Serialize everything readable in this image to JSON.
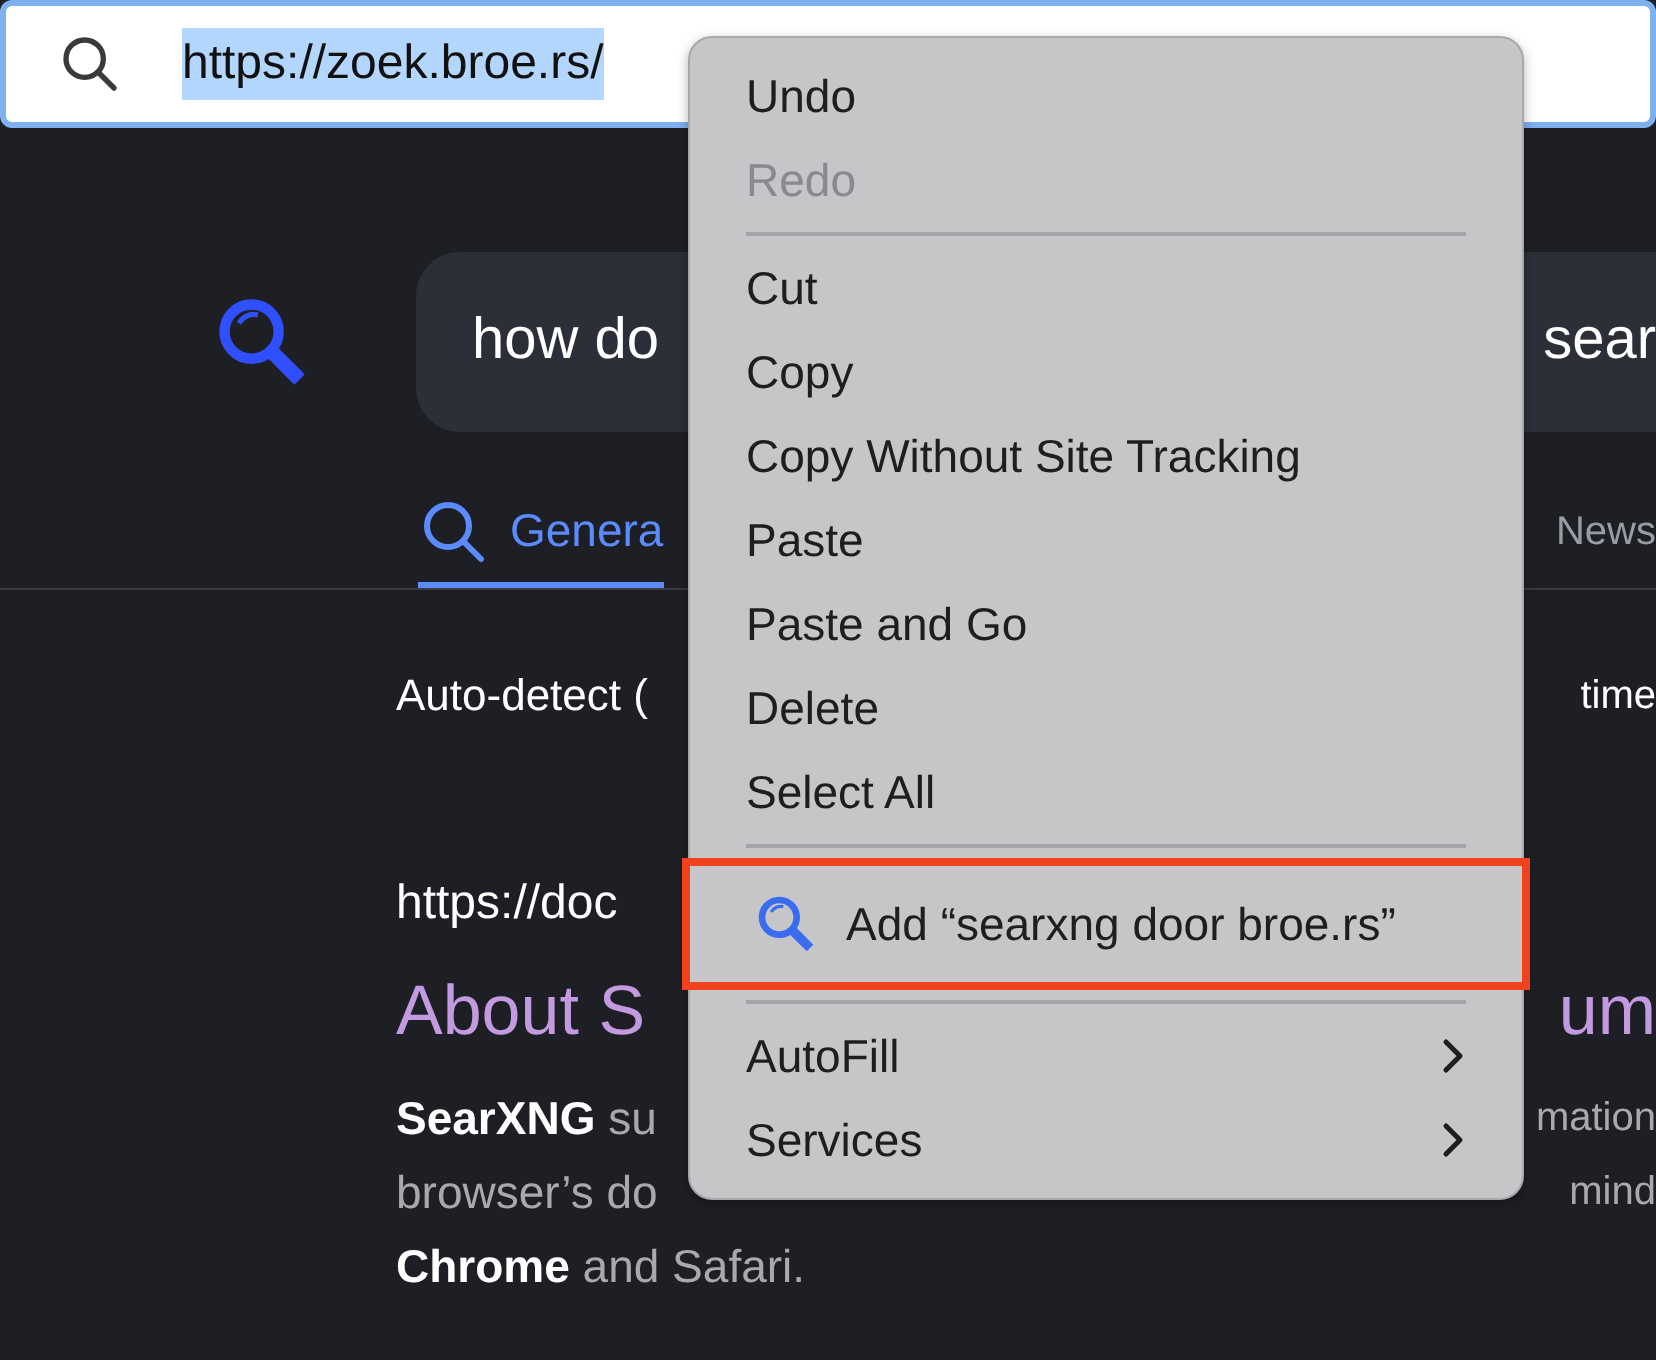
{
  "address_bar": {
    "url": "https://zoek.broe.rs/",
    "selected": true
  },
  "search": {
    "query_left": "how do",
    "query_right": "sear"
  },
  "tabs": [
    {
      "label": "Genera",
      "selected": true
    },
    {
      "label": "News",
      "selected": false
    }
  ],
  "filters": {
    "left": "Auto-detect (",
    "right": "time"
  },
  "result": {
    "url": "https://doc",
    "title_left": "About S",
    "title_right": "um",
    "snippet": [
      {
        "left": "**SearXNG** su",
        "right": "mation"
      },
      {
        "left": "browser’s do",
        "right": "mind"
      },
      {
        "left": "**Chrome** and Safari."
      }
    ]
  },
  "context_menu": {
    "items": [
      {
        "kind": "item",
        "label": "Undo",
        "disabled": false
      },
      {
        "kind": "item",
        "label": "Redo",
        "disabled": true
      },
      {
        "kind": "separator"
      },
      {
        "kind": "item",
        "label": "Cut",
        "disabled": false
      },
      {
        "kind": "item",
        "label": "Copy",
        "disabled": false
      },
      {
        "kind": "item",
        "label": "Copy Without Site Tracking",
        "disabled": false
      },
      {
        "kind": "item",
        "label": "Paste",
        "disabled": false
      },
      {
        "kind": "item",
        "label": "Paste and Go",
        "disabled": false
      },
      {
        "kind": "item",
        "label": "Delete",
        "disabled": false
      },
      {
        "kind": "item",
        "label": "Select All",
        "disabled": false
      },
      {
        "kind": "separator"
      },
      {
        "kind": "search_engine",
        "label": "Add “searxng door broe.rs”",
        "outlined": true
      },
      {
        "kind": "separator"
      },
      {
        "kind": "submenu",
        "label": "AutoFill"
      },
      {
        "kind": "submenu",
        "label": "Services"
      }
    ]
  }
}
